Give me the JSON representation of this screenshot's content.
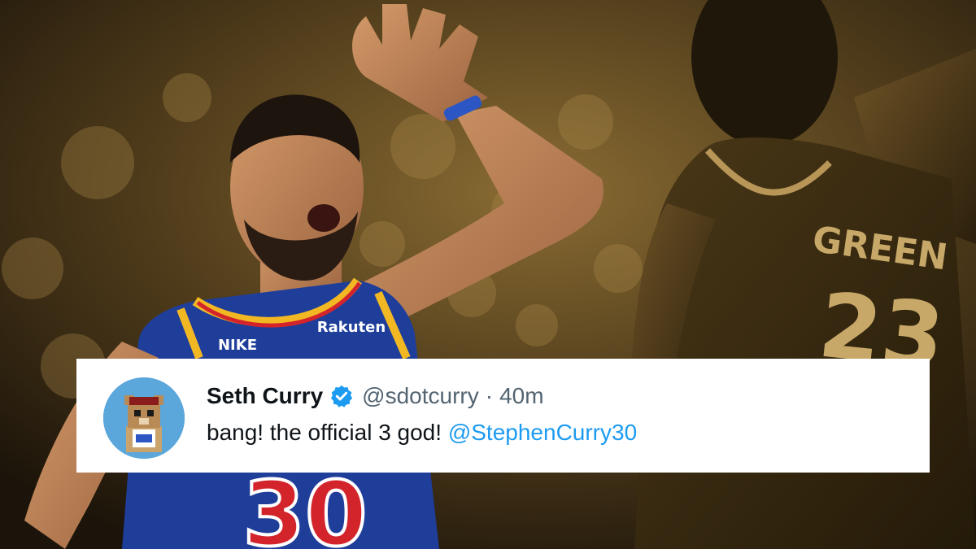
{
  "photo": {
    "jersey_brand": "NIKE",
    "jersey_sponsor": "Rakuten",
    "jersey_number": "30",
    "opponent_name": "GREEN",
    "opponent_number": "23"
  },
  "tweet": {
    "display_name": "Seth Curry",
    "handle": "@sdotcurry",
    "separator": "·",
    "time": "40m",
    "text": "bang! the official 3 god!",
    "mention": "@StephenCurry30",
    "verified_icon": "verified-badge-icon",
    "avatar_icon": "bear-avatar-icon"
  },
  "colors": {
    "link": "#1d9bf0",
    "verified": "#1d9bf0",
    "text": "#0f1419",
    "muted": "#536471",
    "card": "#ffffff",
    "jersey_blue": "#1f3e9a",
    "jersey_gold": "#f2b824",
    "jersey_red": "#d3242b",
    "sepia_dark": "#2a1f0e"
  }
}
